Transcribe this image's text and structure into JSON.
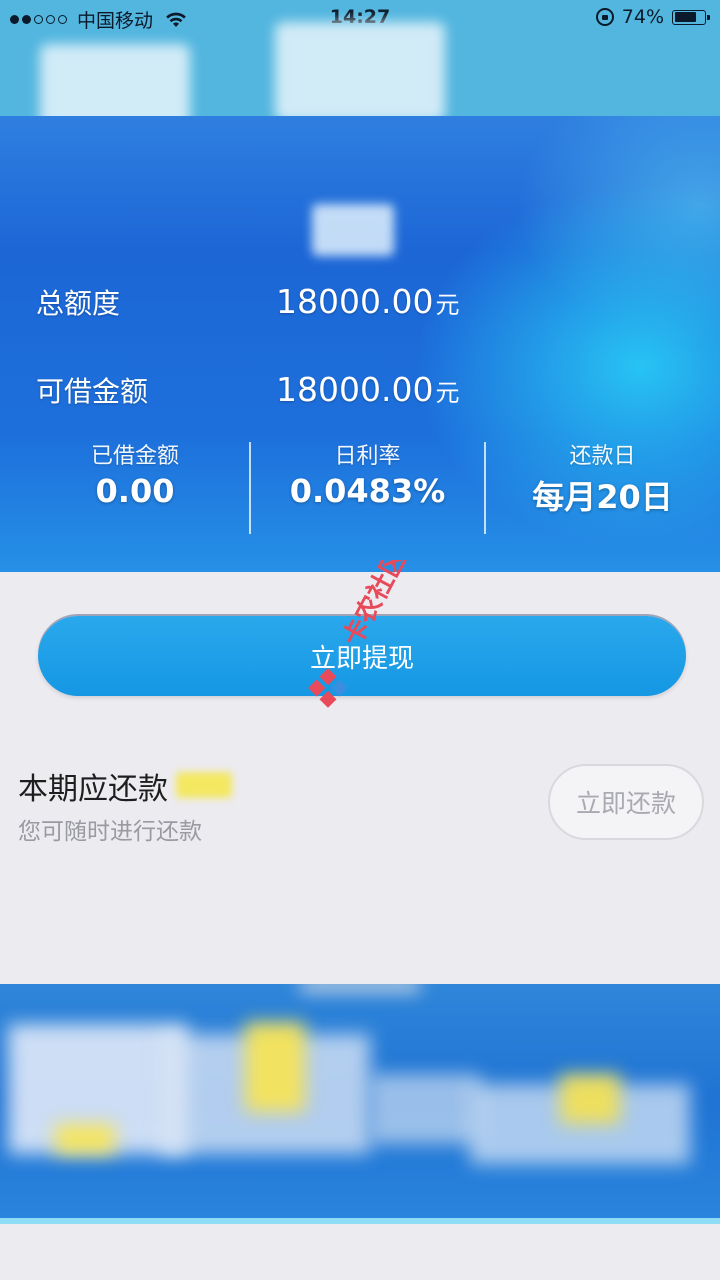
{
  "status_bar": {
    "carrier": "中国移动",
    "time": "14:27",
    "battery_percent": "74%",
    "battery_level": 0.74,
    "signal_strength": 2
  },
  "hero": {
    "total_limit_label": "总额度",
    "total_limit_value": "18000.00",
    "available_label": "可借金额",
    "available_value": "18000.00",
    "currency_unit": "元",
    "stats": {
      "borrowed_label": "已借金额",
      "borrowed_value": "0.00",
      "daily_rate_label": "日利率",
      "daily_rate_value": "0.0483%",
      "repay_day_label": "还款日",
      "repay_day_value": "每月20日"
    }
  },
  "withdraw": {
    "button_label": "立即提现"
  },
  "repayment": {
    "title": "本期应还款",
    "subtitle": "您可随时进行还款",
    "button_label": "立即还款"
  },
  "watermark": {
    "text": "卡农社区"
  },
  "colors": {
    "accent": "#1597e3",
    "hero_blue": "#1c66d6",
    "status_bar": "#52b6df",
    "background": "#ecebf0"
  },
  "icons": [
    "wifi-icon",
    "rotation-lock-icon",
    "battery-icon",
    "signal-icon"
  ]
}
